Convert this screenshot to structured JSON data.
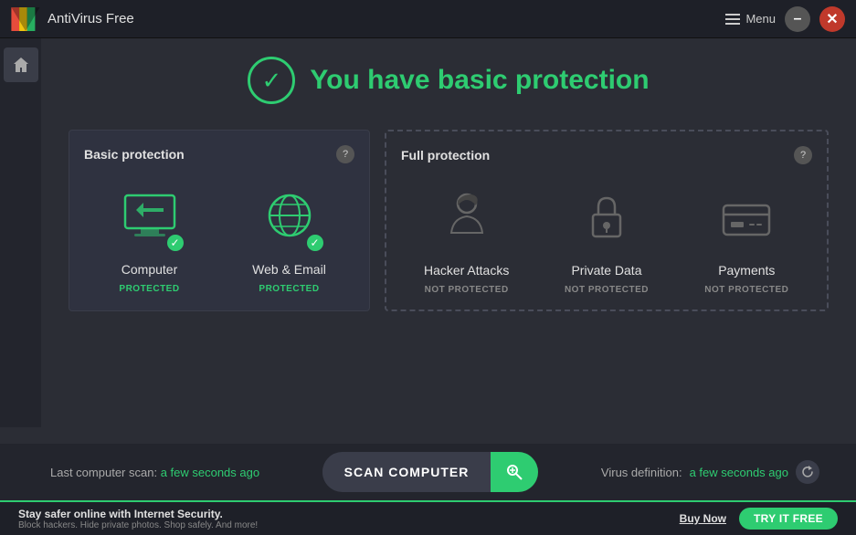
{
  "app": {
    "logo_alt": "AVG logo",
    "title": "AntiVirus Free"
  },
  "titlebar": {
    "menu_label": "Menu",
    "minimize_label": "–",
    "close_label": "✕"
  },
  "status": {
    "message": "You have basic protection"
  },
  "basic_card": {
    "title": "Basic protection",
    "help_label": "?",
    "items": [
      {
        "name": "Computer",
        "status": "PROTECTED",
        "protected": true
      },
      {
        "name": "Web & Email",
        "status": "PROTECTED",
        "protected": true
      }
    ]
  },
  "full_card": {
    "title": "Full protection",
    "help_label": "?",
    "items": [
      {
        "name": "Hacker Attacks",
        "status": "NOT PROTECTED",
        "protected": false
      },
      {
        "name": "Private Data",
        "status": "NOT PROTECTED",
        "protected": false
      },
      {
        "name": "Payments",
        "status": "NOT PROTECTED",
        "protected": false
      }
    ]
  },
  "scan_bar": {
    "last_scan_label": "Last computer scan:",
    "last_scan_time": "a few seconds ago",
    "scan_button_label": "SCAN COMPUTER",
    "virus_def_label": "Virus definition:",
    "virus_def_time": "a few seconds ago"
  },
  "banner": {
    "title": "Stay safer online with Internet Security.",
    "subtitle": "Block hackers. Hide private photos. Shop safely. And more!",
    "buy_label": "Buy Now",
    "try_label": "TRY IT FREE"
  },
  "colors": {
    "accent_green": "#2ecc71",
    "not_protected_gray": "#888888"
  }
}
